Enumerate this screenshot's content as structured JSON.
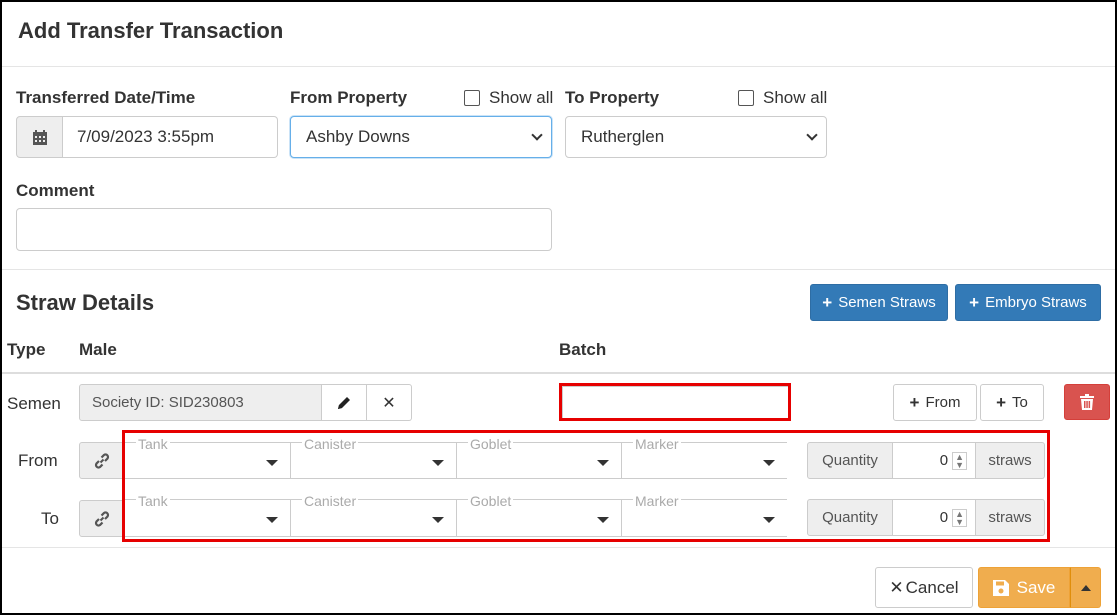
{
  "modal": {
    "title": "Add Transfer Transaction"
  },
  "form": {
    "date_label": "Transferred Date/Time",
    "date_value": "7/09/2023 3:55pm",
    "from_label": "From Property",
    "from_value": "Ashby Downs",
    "show_all": "Show all",
    "to_label": "To Property",
    "to_value": "Rutherglen",
    "comment_label": "Comment",
    "comment_value": ""
  },
  "straws": {
    "heading": "Straw Details",
    "semen_button": "Semen Straws",
    "embryo_button": "Embryo Straws",
    "col_type": "Type",
    "col_male": "Male",
    "col_batch": "Batch",
    "row_type": "Semen",
    "male_value": "Society ID: SID230803",
    "batch_value": "",
    "from_button": "From",
    "to_button": "To",
    "from_label": "From",
    "to_label": "To",
    "fields": {
      "tank": "Tank",
      "canister": "Canister",
      "goblet": "Goblet",
      "marker": "Marker"
    },
    "quantity_label": "Quantity",
    "from_quantity": "0",
    "to_quantity": "0",
    "unit": "straws"
  },
  "footer": {
    "cancel": "Cancel",
    "save": "Save"
  },
  "colors": {
    "primary": "#337ab7",
    "danger": "#d9534f",
    "warning": "#f0ad4e",
    "highlight": "#e60000"
  }
}
